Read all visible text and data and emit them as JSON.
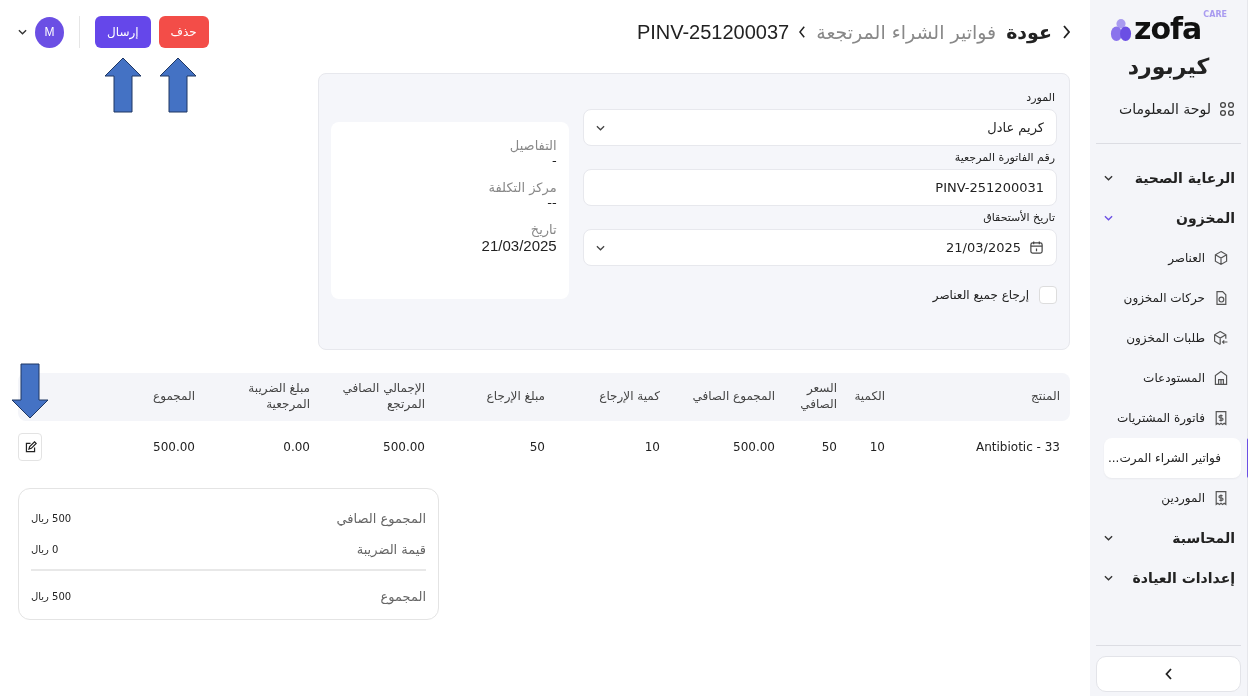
{
  "sidebar": {
    "logo": {
      "name": "zofa",
      "tag": "CARE"
    },
    "clinic_name": "كيربورد",
    "dashboard": {
      "label": "لوحة المعلومات"
    },
    "groups": [
      {
        "label": "الرعاية الصحية",
        "expanded": false
      },
      {
        "label": "المخزون",
        "expanded": true,
        "children": [
          {
            "label": "العناصر",
            "selected": false
          },
          {
            "label": "حركات المخزون",
            "selected": false
          },
          {
            "label": "طلبات المخزون",
            "selected": false
          },
          {
            "label": "المستودعات",
            "selected": false
          },
          {
            "label": "فاتورة المشتريات",
            "selected": false
          },
          {
            "label": "فواتير الشراء المرت...",
            "selected": true
          },
          {
            "label": "الموردين",
            "selected": false
          }
        ]
      },
      {
        "label": "المحاسبة",
        "expanded": false
      },
      {
        "label": "إعدادات العيادة",
        "expanded": false
      }
    ]
  },
  "header": {
    "back": "عودة",
    "breadcrumb": "فواتير الشراء المرتجعة",
    "current": "PINV-251200037"
  },
  "actions": [
    {
      "label": "حذف",
      "kind": "danger"
    },
    {
      "label": "إرسال",
      "kind": "primary"
    }
  ],
  "user": {
    "initial": "M"
  },
  "form": {
    "fields": [
      {
        "kind": "select",
        "label": "المورد",
        "value": "كريم عادل"
      },
      {
        "kind": "text",
        "label": "رقم الفاتورة المرجعية",
        "value": "PINV-251200031"
      },
      {
        "kind": "date",
        "label": "تاريخ الأستحقاق",
        "value": "21/03/2025"
      }
    ],
    "return_all": {
      "label": "إرجاع جميع العناصر",
      "checked": false
    }
  },
  "details": [
    {
      "label": "التفاصيل",
      "value": "-"
    },
    {
      "label": "مركز التكلفة",
      "value": "--"
    },
    {
      "label": "تاريخ",
      "value": "21/03/2025"
    }
  ],
  "table": {
    "columns": [
      "المنتج",
      "الكمية",
      "السعر الصافي",
      "المجموع الصافي",
      "كمية الإرجاع",
      "مبلغ الإرجاع",
      "الإجمالي الصافي المرتجع",
      "مبلغ الضريبة المرجعية",
      "المجموع"
    ],
    "rows": [
      {
        "cells": [
          "Antibiotic - 33",
          "10",
          "50",
          "500.00",
          "10",
          "50",
          "500.00",
          "0.00",
          "500.00"
        ]
      }
    ]
  },
  "summary": [
    {
      "label": "المجموع الصافي",
      "value": "500 ريال",
      "kind": "line"
    },
    {
      "label": "قيمة الضريبة",
      "value": "0 ريال",
      "kind": "line"
    },
    {
      "label": "المجموع",
      "value": "500 ريال",
      "kind": "total"
    }
  ]
}
